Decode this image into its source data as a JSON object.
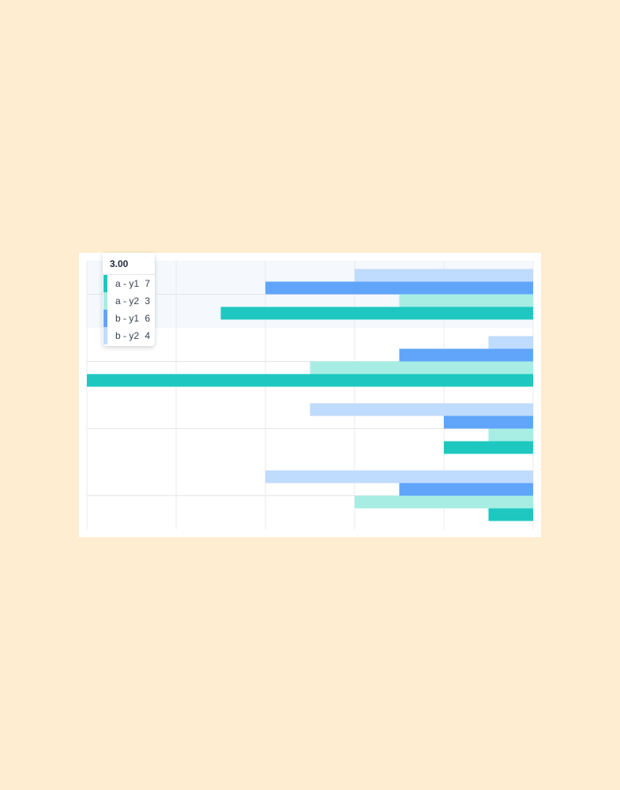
{
  "chart_data": {
    "type": "bar",
    "orientation": "horizontal",
    "stacked": false,
    "x_reversed": true,
    "xlim": [
      0,
      10
    ],
    "grid": true,
    "categories": [
      "3.00",
      "",
      "",
      ""
    ],
    "series": [
      {
        "name": "b - y2",
        "color": "#BFDBFE",
        "values": [
          4,
          1,
          5,
          6
        ]
      },
      {
        "name": "b - y1",
        "color": "#60A5FA",
        "values": [
          6,
          3,
          2,
          3
        ]
      },
      {
        "name": "a - y2",
        "color": "#A7EDE4",
        "values": [
          3,
          5,
          1,
          4
        ]
      },
      {
        "name": "a - y1",
        "color": "#1EC8C0",
        "values": [
          7,
          10,
          2,
          1
        ]
      }
    ],
    "highlighted_category_index": 0
  },
  "tooltip": {
    "title": "3.00",
    "rows": [
      {
        "label": "a - y1",
        "value": "7",
        "color": "#1EC8C0"
      },
      {
        "label": "a - y2",
        "value": "3",
        "color": "#A7EDE4"
      },
      {
        "label": "b - y1",
        "value": "6",
        "color": "#60A5FA"
      },
      {
        "label": "b - y2",
        "value": "4",
        "color": "#BFDBFE"
      }
    ]
  }
}
